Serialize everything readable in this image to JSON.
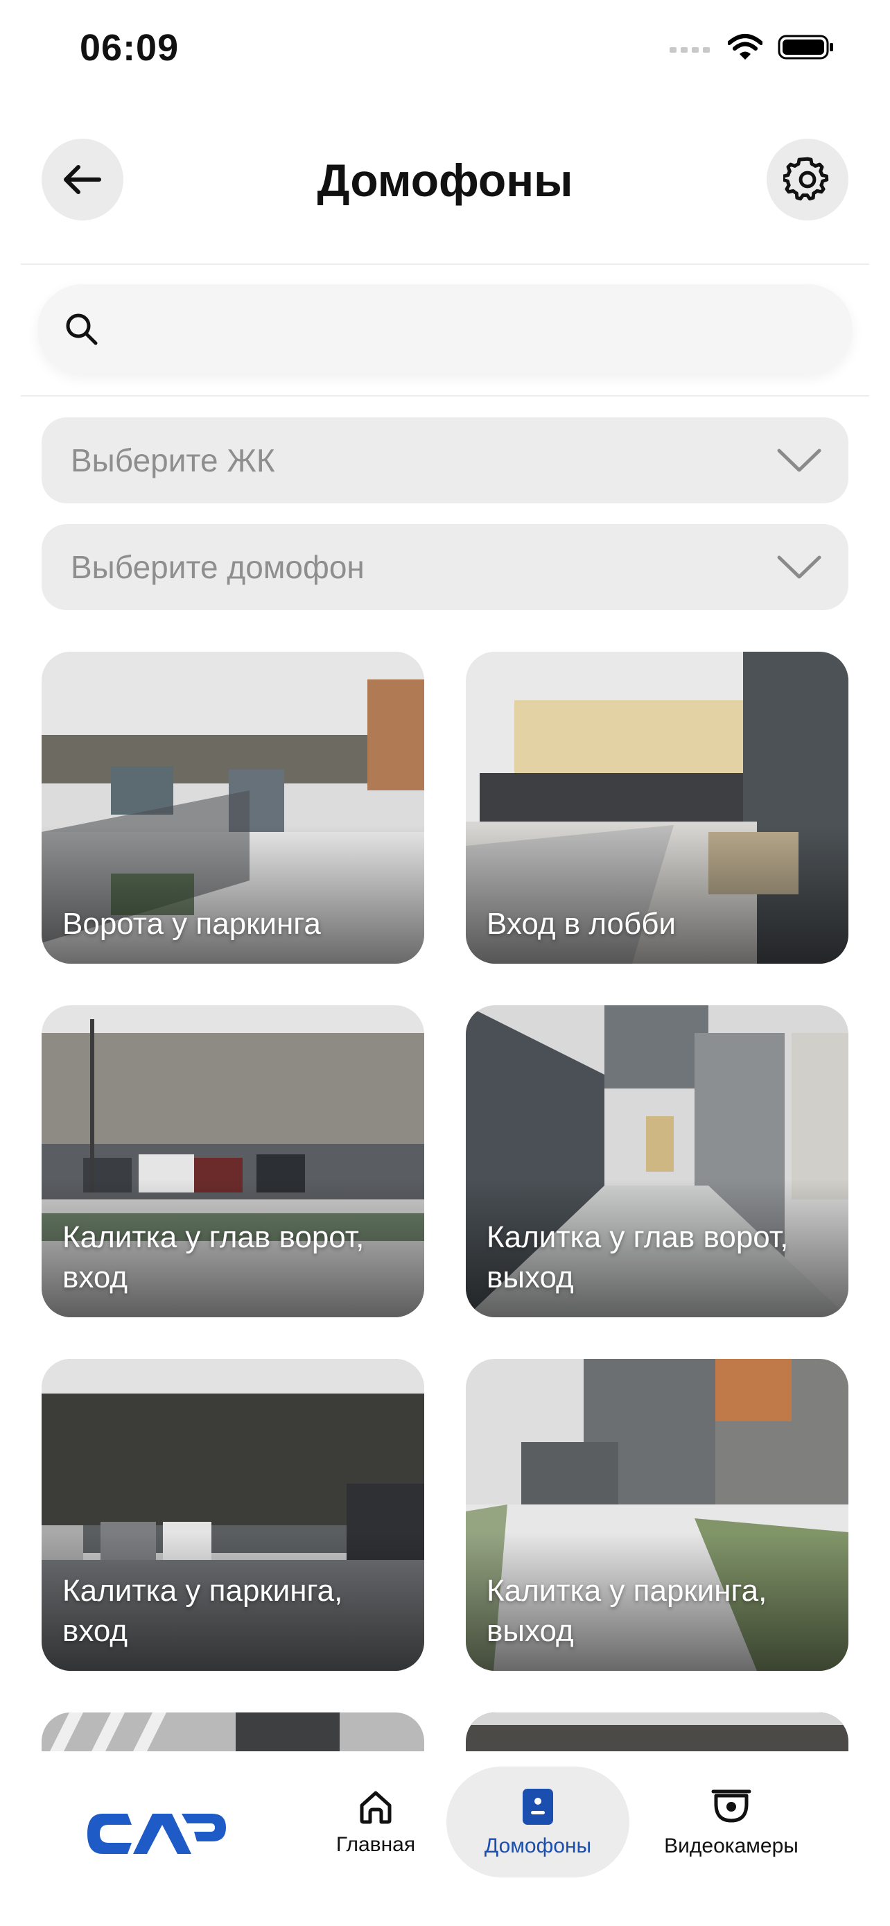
{
  "status_bar": {
    "time": "06:09"
  },
  "header": {
    "title": "Домофоны"
  },
  "search": {
    "placeholder": "",
    "value": ""
  },
  "filters": {
    "complex_placeholder": "Выберите ЖК",
    "intercom_placeholder": "Выберите домофон"
  },
  "cameras": [
    {
      "label": "Ворота у паркинга"
    },
    {
      "label": "Вход в лобби"
    },
    {
      "label": "Калитка у глав ворот, вход"
    },
    {
      "label": "Калитка у глав ворот, выход"
    },
    {
      "label": "Калитка у паркинга, вход"
    },
    {
      "label": "Калитка у паркинга, выход"
    }
  ],
  "bottom_nav": {
    "logo_text": "САР",
    "items": [
      {
        "label": "Главная",
        "icon": "home-icon",
        "active": false
      },
      {
        "label": "Домофоны",
        "icon": "intercom-icon",
        "active": true
      },
      {
        "label": "Видеокамеры",
        "icon": "cctv-camera-icon",
        "active": false
      }
    ]
  },
  "colors": {
    "accent": "#1a4fb0",
    "logo": "#1f5bc6",
    "field_bg": "#ececec"
  }
}
